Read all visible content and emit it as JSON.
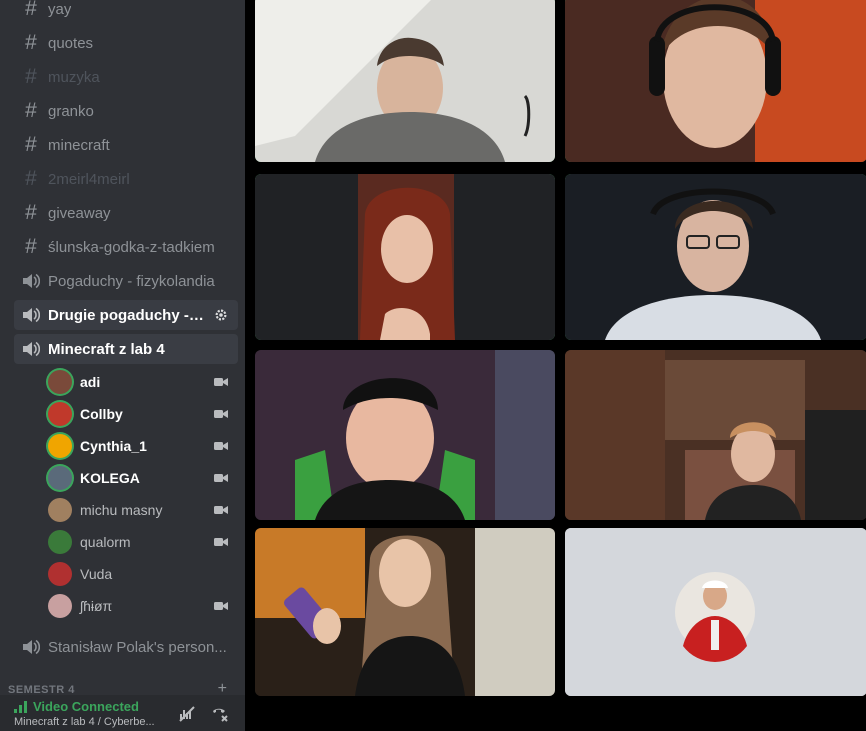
{
  "sidebar": {
    "channels": [
      {
        "name": "yay",
        "type": "text",
        "muted": false
      },
      {
        "name": "quotes",
        "type": "text",
        "muted": false
      },
      {
        "name": "muzyka",
        "type": "text",
        "muted": true
      },
      {
        "name": "granko",
        "type": "text",
        "muted": false
      },
      {
        "name": "minecraft",
        "type": "text",
        "muted": false
      },
      {
        "name": "2meirl4meirl",
        "type": "text",
        "muted": true
      },
      {
        "name": "giveaway",
        "type": "text",
        "muted": false
      },
      {
        "name": "ślunska-godka-z-tadkiem",
        "type": "text-thread",
        "muted": false
      },
      {
        "name": "Pogaduchy - fizykolandia",
        "type": "voice",
        "muted": false
      },
      {
        "name": "Drugie pogaduchy - T...",
        "type": "voice",
        "muted": false
      },
      {
        "name": "Minecraft z lab 4",
        "type": "voice",
        "muted": false
      }
    ],
    "members": [
      {
        "name": "adi",
        "camera": true,
        "speaking": true,
        "avatar_color": "#7a4a3a"
      },
      {
        "name": "Collby",
        "camera": true,
        "speaking": true,
        "avatar_color": "#c0392b"
      },
      {
        "name": "Cynthia_1",
        "camera": true,
        "speaking": true,
        "avatar_color": "#f0a500"
      },
      {
        "name": "KOLEGA",
        "camera": true,
        "speaking": true,
        "avatar_color": "#5a6a7a"
      },
      {
        "name": "michu masny",
        "camera": true,
        "speaking": false,
        "avatar_color": "#a08060"
      },
      {
        "name": "qualorm",
        "camera": true,
        "speaking": false,
        "avatar_color": "#3a7a3a"
      },
      {
        "name": "Vuda",
        "camera": false,
        "speaking": false,
        "avatar_color": "#b03030"
      },
      {
        "name": "ʃɦɨøπ",
        "camera": true,
        "speaking": false,
        "avatar_color": "#c8a0a0"
      }
    ],
    "extra_channel": "Stanisław Polak's person...",
    "category": "SEMESTR 4",
    "category_plus": "+"
  },
  "voice_panel": {
    "status": "Video Connected",
    "channel": "Minecraft z lab 4 / Cyberbe..."
  },
  "colors": {
    "sidebar_bg": "#2f3136",
    "speaking": "#3ba55c",
    "panel_bg": "#292b2f"
  }
}
